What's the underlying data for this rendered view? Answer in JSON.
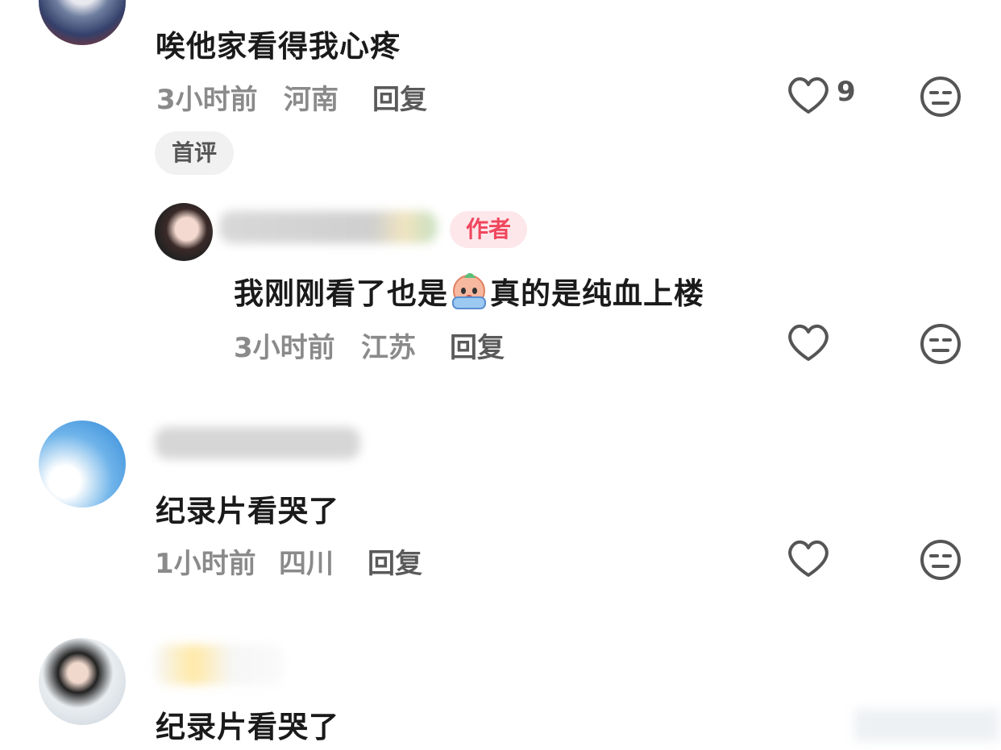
{
  "comments": [
    {
      "text": "唉他家看得我心疼",
      "time": "3小时前",
      "location": "河南",
      "reply_label": "回复",
      "likes": "9",
      "badge": "首评"
    },
    {
      "badge": "作者",
      "text_before": "我刚刚看了也是",
      "text_after": "真的是纯血上楼",
      "time": "3小时前",
      "location": "江苏",
      "reply_label": "回复"
    },
    {
      "text": "纪录片看哭了",
      "time": "1小时前",
      "location": "四川",
      "reply_label": "回复"
    },
    {
      "text": "纪录片看哭了"
    }
  ],
  "colors": {
    "text": "#1a1a1a",
    "meta": "#8a8a8a",
    "icon": "#555555",
    "author_badge_bg": "#fde7ea",
    "author_badge_text": "#f0475e",
    "first_badge_bg": "#f1f1f1"
  },
  "icons": [
    "heart-icon",
    "unamused-face-icon",
    "crying-emoji-icon"
  ]
}
